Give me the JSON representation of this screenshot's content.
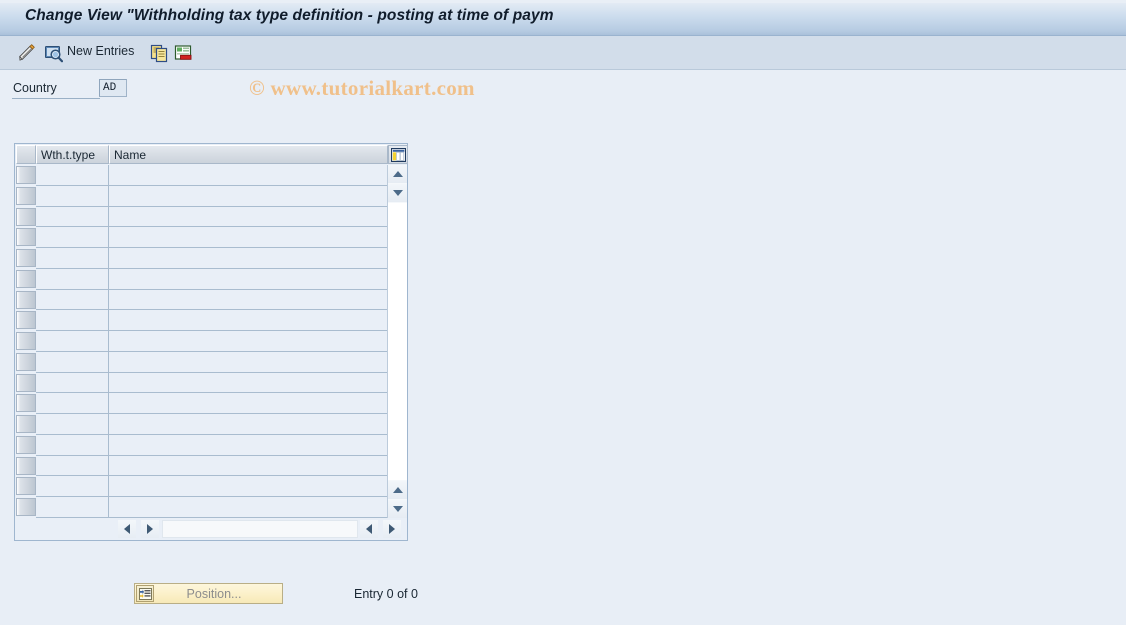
{
  "window": {
    "title": "Change View \"Withholding tax type definition - posting at time of paym"
  },
  "toolbar": {
    "display_change_icon": "pencil-display-change-icon",
    "select_detail_icon": "magnifier-detail-icon",
    "new_entries_label": "New Entries",
    "copy_icon": "copy-as-icon",
    "delete_icon": "delete-row-icon"
  },
  "watermark": {
    "text": "© www.tutorialkart.com",
    "color": "#f0c08a"
  },
  "form": {
    "country_label": "Country",
    "country_value": "AD",
    "country_placeholder": ""
  },
  "table": {
    "config_icon": "table-settings-icon",
    "columns": [
      {
        "key": "select_all",
        "label": ""
      },
      {
        "key": "wth_t_type",
        "label": "Wth.t.type"
      },
      {
        "key": "name",
        "label": "Name"
      }
    ],
    "rows": [
      {
        "wth_t_type": "",
        "name": ""
      },
      {
        "wth_t_type": "",
        "name": ""
      },
      {
        "wth_t_type": "",
        "name": ""
      },
      {
        "wth_t_type": "",
        "name": ""
      },
      {
        "wth_t_type": "",
        "name": ""
      },
      {
        "wth_t_type": "",
        "name": ""
      },
      {
        "wth_t_type": "",
        "name": ""
      },
      {
        "wth_t_type": "",
        "name": ""
      },
      {
        "wth_t_type": "",
        "name": ""
      },
      {
        "wth_t_type": "",
        "name": ""
      },
      {
        "wth_t_type": "",
        "name": ""
      },
      {
        "wth_t_type": "",
        "name": ""
      },
      {
        "wth_t_type": "",
        "name": ""
      },
      {
        "wth_t_type": "",
        "name": ""
      },
      {
        "wth_t_type": "",
        "name": ""
      },
      {
        "wth_t_type": "",
        "name": ""
      },
      {
        "wth_t_type": "",
        "name": ""
      }
    ],
    "vscroll": {
      "up_icon": "scroll-up-icon",
      "down_icon": "scroll-down-icon"
    },
    "hscroll": {
      "left_icon": "scroll-left-icon",
      "right_icon": "scroll-right-icon"
    }
  },
  "footer": {
    "position_button_label": "Position...",
    "position_button_icon": "position-icon",
    "entry_count": "Entry 0 of 0"
  }
}
